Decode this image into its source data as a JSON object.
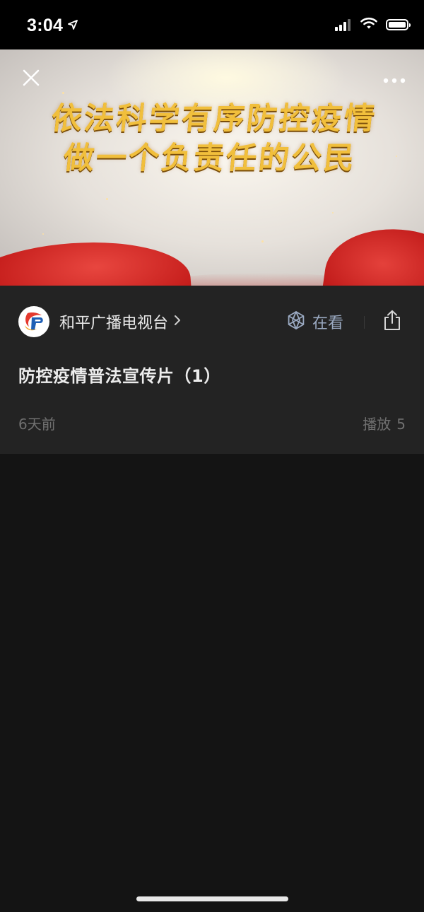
{
  "status_bar": {
    "time": "3:04",
    "icons": [
      "location-arrow-icon",
      "cellular-signal-icon",
      "wifi-icon",
      "battery-icon"
    ]
  },
  "video": {
    "overlay_lines": [
      "依法科学有序防控疫情",
      "做一个负责任的公民"
    ],
    "controls": {
      "close_icon": "close-icon",
      "more_icon": "more-horizontal-icon"
    }
  },
  "account": {
    "name": "和平广播电视台",
    "chevron_icon": "chevron-right-icon"
  },
  "actions": {
    "watching_label": "在看",
    "watching_icon": "watching-flower-icon",
    "share_icon": "share-icon"
  },
  "details": {
    "title": "防控疫情普法宣传片（1）",
    "posted": "6天前",
    "plays_label": "播放",
    "plays_count": "5"
  },
  "colors": {
    "panel_bg": "#232323",
    "page_bg": "#141414",
    "accent_watching": "#9aa9c1",
    "overlay_text_gold": "#f1bf3c",
    "flag_red": "#c51d1b"
  }
}
